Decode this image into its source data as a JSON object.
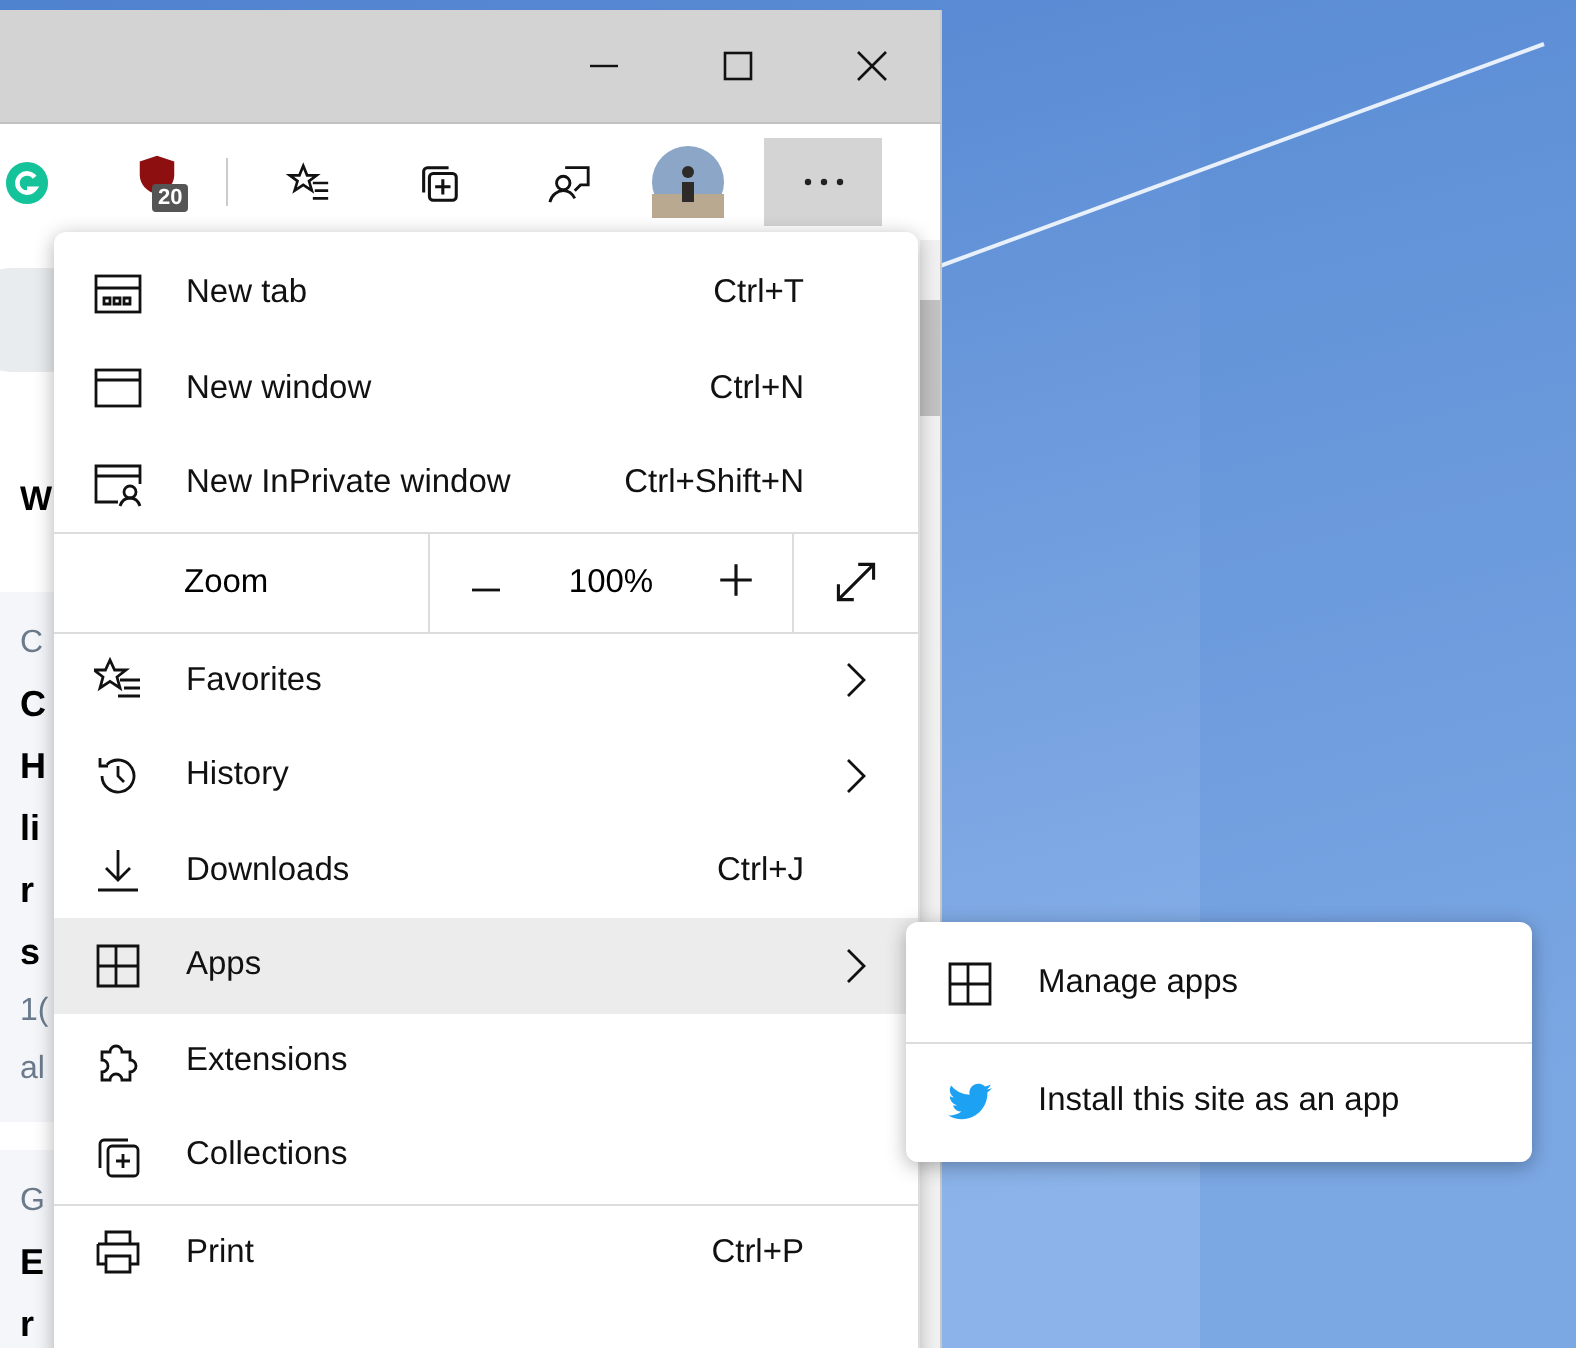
{
  "toolbar": {
    "extension_badge": "20"
  },
  "page": {
    "heading": "W",
    "cards": [
      {
        "category": "C",
        "headline": [
          "C",
          "H",
          "li",
          "r",
          "s"
        ],
        "meta": [
          "1(",
          "al"
        ]
      },
      {
        "category": "G",
        "headline": [
          "E",
          "r"
        ]
      }
    ]
  },
  "menu": [
    {
      "kind": "item",
      "label": "New tab",
      "shortcut": "Ctrl+T",
      "submenu": false,
      "selected": false
    },
    {
      "kind": "item",
      "label": "New window",
      "shortcut": "Ctrl+N",
      "submenu": false,
      "selected": false
    },
    {
      "kind": "item",
      "label": "New InPrivate window",
      "shortcut": "Ctrl+Shift+N",
      "submenu": false,
      "selected": false
    },
    {
      "kind": "divider"
    },
    {
      "kind": "zoom",
      "label": "Zoom",
      "value": "100%"
    },
    {
      "kind": "divider"
    },
    {
      "kind": "item",
      "label": "Favorites",
      "submenu": true,
      "selected": false
    },
    {
      "kind": "item",
      "label": "History",
      "submenu": true,
      "selected": false
    },
    {
      "kind": "item",
      "label": "Downloads",
      "shortcut": "Ctrl+J",
      "submenu": false,
      "selected": false
    },
    {
      "kind": "item",
      "label": "Apps",
      "submenu": true,
      "selected": true
    },
    {
      "kind": "item",
      "label": "Extensions",
      "submenu": false,
      "selected": false
    },
    {
      "kind": "item",
      "label": "Collections",
      "submenu": false,
      "selected": false
    },
    {
      "kind": "divider"
    },
    {
      "kind": "item",
      "label": "Print",
      "shortcut": "Ctrl+P",
      "submenu": false,
      "selected": false
    }
  ],
  "submenu": [
    {
      "label": "Manage apps"
    },
    {
      "label": "Install this site as an app"
    }
  ]
}
